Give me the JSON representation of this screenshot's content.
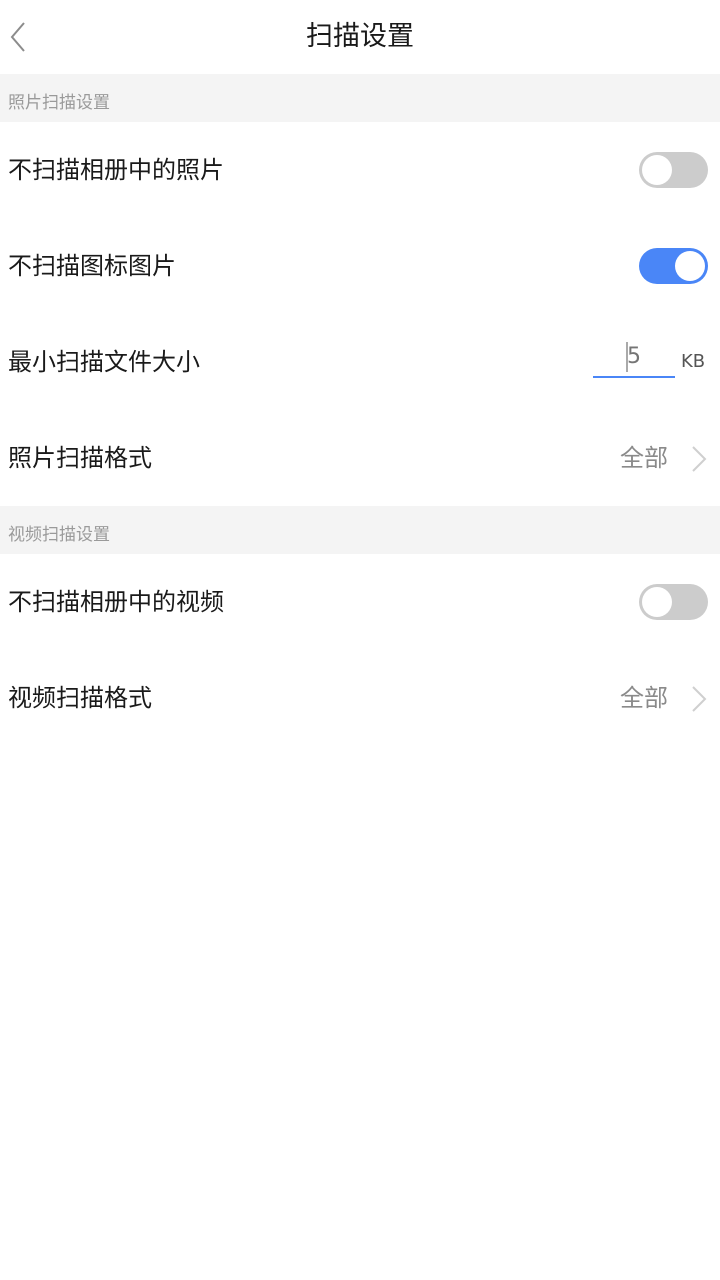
{
  "nav": {
    "title": "扫描设置",
    "back_icon": "chevron-left-icon"
  },
  "photo_section": {
    "header": "照片扫描设置",
    "skip_album_photos": {
      "label": "不扫描相册中的照片",
      "enabled": false
    },
    "skip_icon_images": {
      "label": "不扫描图标图片",
      "enabled": true
    },
    "min_file_size": {
      "label": "最小扫描文件大小",
      "placeholder": "5",
      "value": "",
      "unit": "KB"
    },
    "photo_format": {
      "label": "照片扫描格式",
      "value": "全部"
    }
  },
  "video_section": {
    "header": "视频扫描设置",
    "skip_album_videos": {
      "label": "不扫描相册中的视频",
      "enabled": false
    },
    "video_format": {
      "label": "视频扫描格式",
      "value": "全部"
    }
  },
  "colors": {
    "accent": "#4a86f7",
    "toggle_off": "#cccccc",
    "section_bg": "#f4f4f4"
  }
}
